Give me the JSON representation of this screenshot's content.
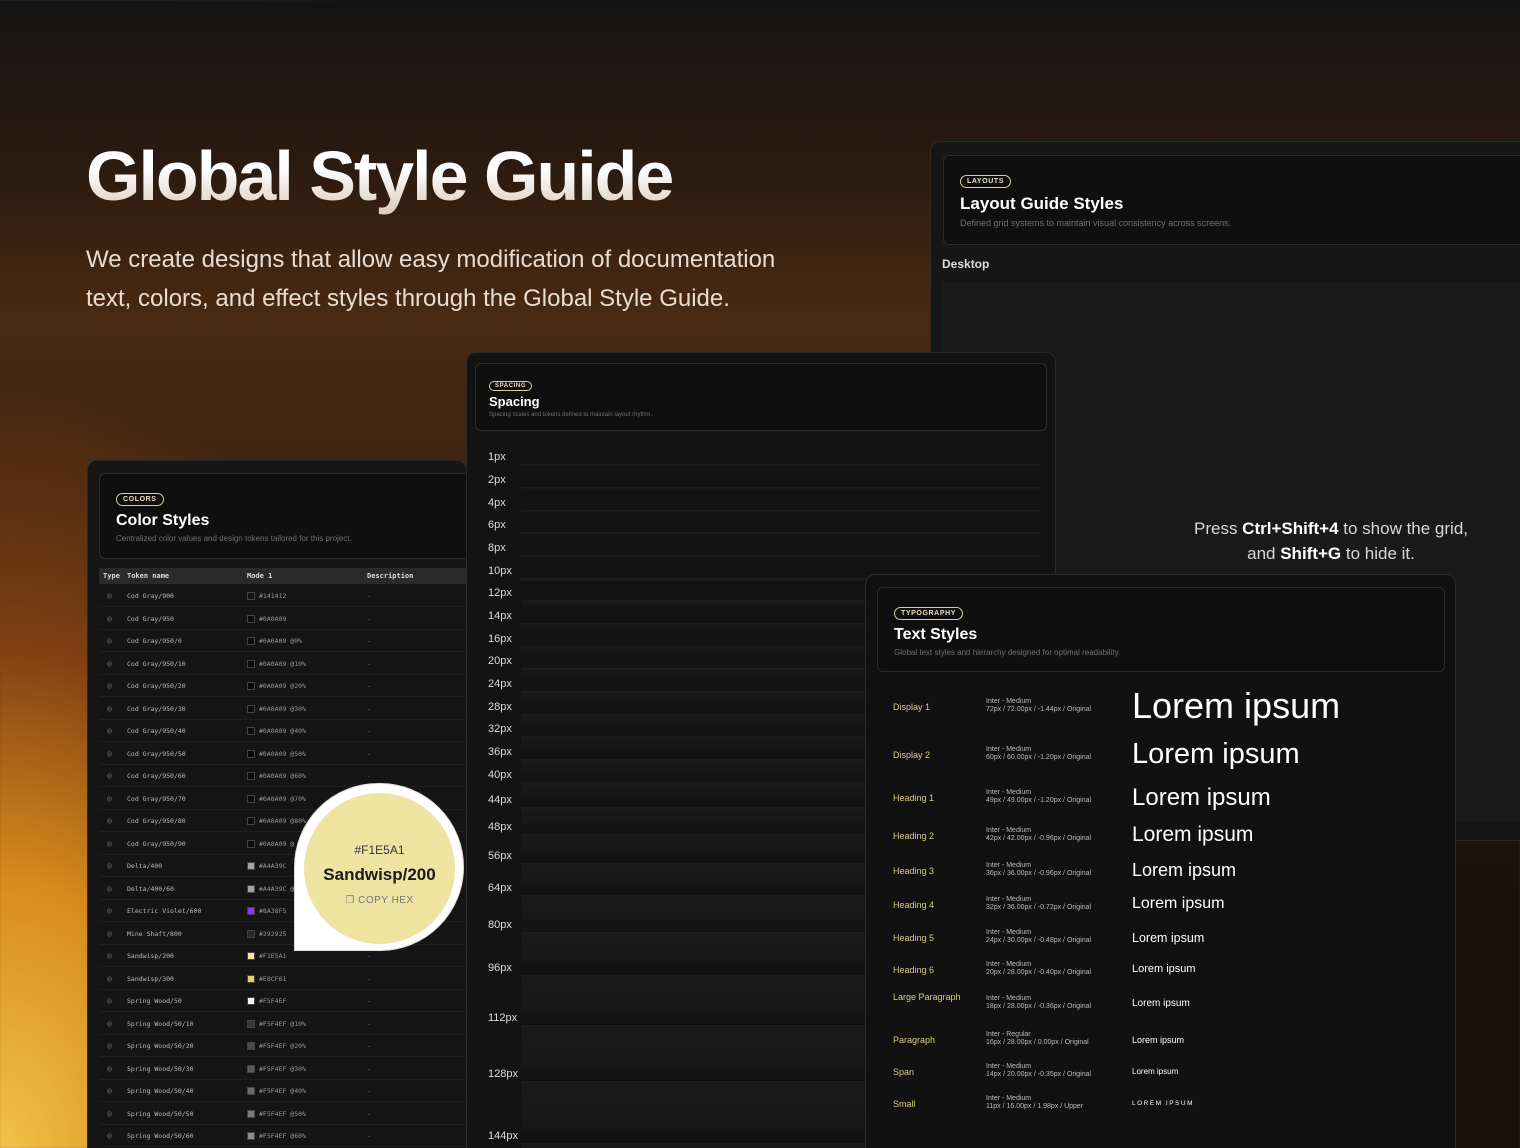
{
  "hero": {
    "title": "Global Style Guide",
    "subtitle": "We create designs that allow easy modification of documentation text, colors, and effect styles through the Global Style Guide."
  },
  "layout_panel": {
    "badge": "LAYOUTS",
    "title": "Layout Guide Styles",
    "description": "Defined grid systems to maintain visual consistency across screens.",
    "tab": "Desktop"
  },
  "grid_hint": {
    "prefix": "Press ",
    "key1": "Ctrl+Shift+4",
    "mid": " to show the grid, and ",
    "key2": "Shift+G",
    "suffix": " to hide it."
  },
  "spacing_panel": {
    "badge": "SPACING",
    "title": "Spacing",
    "description": "Spacing scales and tokens defined to maintain layout rhythm.",
    "items": [
      "1px",
      "2px",
      "4px",
      "6px",
      "8px",
      "10px",
      "12px",
      "14px",
      "16px",
      "20px",
      "24px",
      "28px",
      "32px",
      "36px",
      "40px",
      "44px",
      "48px",
      "56px",
      "64px",
      "80px",
      "96px",
      "112px",
      "128px",
      "144px"
    ]
  },
  "color_panel": {
    "badge": "COLORS",
    "title": "Color Styles",
    "description": "Centralized color values and design tokens tailored for this project.",
    "columns": [
      "Type",
      "Token name",
      "Mode 1",
      "Description"
    ],
    "rows": [
      {
        "name": "Cod Gray/900",
        "hex": "#141412",
        "swatch": "#141412",
        "desc": "-"
      },
      {
        "name": "Cod Gray/950",
        "hex": "#0A0A09",
        "swatch": "#0A0A09",
        "desc": "-"
      },
      {
        "name": "Cod Gray/950/0",
        "hex": "#0A0A09 @0%",
        "swatch": "#0A0A09",
        "desc": "-"
      },
      {
        "name": "Cod Gray/950/10",
        "hex": "#0A0A09 @10%",
        "swatch": "#0A0A09",
        "desc": "-"
      },
      {
        "name": "Cod Gray/950/20",
        "hex": "#0A0A09 @20%",
        "swatch": "#0A0A09",
        "desc": "-"
      },
      {
        "name": "Cod Gray/950/30",
        "hex": "#0A0A09 @30%",
        "swatch": "#0A0A09",
        "desc": "-"
      },
      {
        "name": "Cod Gray/950/40",
        "hex": "#0A0A09 @40%",
        "swatch": "#0A0A09",
        "desc": "-"
      },
      {
        "name": "Cod Gray/950/50",
        "hex": "#0A0A09 @50%",
        "swatch": "#0A0A09",
        "desc": "-"
      },
      {
        "name": "Cod Gray/950/60",
        "hex": "#0A0A09 @60%",
        "swatch": "#0A0A09",
        "desc": "-"
      },
      {
        "name": "Cod Gray/950/70",
        "hex": "#0A0A09 @70%",
        "swatch": "#0A0A09",
        "desc": "-"
      },
      {
        "name": "Cod Gray/950/80",
        "hex": "#0A0A09 @80%",
        "swatch": "#0A0A09",
        "desc": "-"
      },
      {
        "name": "Cod Gray/950/90",
        "hex": "#0A0A09 @",
        "swatch": "#0A0A09",
        "desc": "-"
      },
      {
        "name": "Delta/400",
        "hex": "#A4A39C",
        "swatch": "#A4A39C",
        "desc": "-"
      },
      {
        "name": "Delta/400/60",
        "hex": "#A4A39C @",
        "swatch": "#A4A39C",
        "desc": "-"
      },
      {
        "name": "Electric Violet/600",
        "hex": "#8A38F5",
        "swatch": "#8A38F5",
        "desc": "-"
      },
      {
        "name": "Mine Shaft/800",
        "hex": "#292925",
        "swatch": "#292925",
        "desc": "-"
      },
      {
        "name": "Sandwisp/200",
        "hex": "#F1E5A1",
        "swatch": "#F1E5A1",
        "desc": "-"
      },
      {
        "name": "Sandwisp/300",
        "hex": "#E8CF61",
        "swatch": "#E8CF61",
        "desc": "-"
      },
      {
        "name": "Spring Wood/50",
        "hex": "#F5F4EF",
        "swatch": "#F5F4EF",
        "desc": "-"
      },
      {
        "name": "Spring Wood/50/10",
        "hex": "#F5F4EF @10%",
        "swatch": "#3a3a38",
        "desc": "-"
      },
      {
        "name": "Spring Wood/50/20",
        "hex": "#F5F4EF @20%",
        "swatch": "#4a4a48",
        "desc": "-"
      },
      {
        "name": "Spring Wood/50/30",
        "hex": "#F5F4EF @30%",
        "swatch": "#5a5a58",
        "desc": "-"
      },
      {
        "name": "Spring Wood/50/40",
        "hex": "#F5F4EF @40%",
        "swatch": "#6a6a68",
        "desc": "-"
      },
      {
        "name": "Spring Wood/50/50",
        "hex": "#F5F4EF @50%",
        "swatch": "#7a7a78",
        "desc": "-"
      },
      {
        "name": "Spring Wood/50/60",
        "hex": "#F5F4EF @60%",
        "swatch": "#8a8a88",
        "desc": "-"
      }
    ]
  },
  "copy_popover": {
    "hex": "#F1E5A1",
    "name": "Sandwisp/200",
    "action": "COPY HEX",
    "color": "#efe3a2"
  },
  "type_panel": {
    "badge": "TYPOGRAPHY",
    "title": "Text Styles",
    "description": "Global text styles and hierarchy designed for optimal readability.",
    "styles": [
      {
        "name": "Display 1",
        "font": "Inter - Medium",
        "spec": "72px / 72.00px / -1.44px / Original",
        "sample": "Lorem ipsum"
      },
      {
        "name": "Display 2",
        "font": "Inter - Medium",
        "spec": "60px / 60.00px / -1.20px / Original",
        "sample": "Lorem ipsum"
      },
      {
        "name": "Heading 1",
        "font": "Inter - Medium",
        "spec": "49px / 49.00px / -1.20px / Original",
        "sample": "Lorem ipsum"
      },
      {
        "name": "Heading 2",
        "font": "Inter - Medium",
        "spec": "42px / 42.00px / -0.96px / Original",
        "sample": "Lorem ipsum"
      },
      {
        "name": "Heading 3",
        "font": "Inter - Medium",
        "spec": "36px / 36.00px / -0.96px / Original",
        "sample": "Lorem ipsum"
      },
      {
        "name": "Heading 4",
        "font": "Inter - Medium",
        "spec": "32px / 36.00px / -0.72px / Original",
        "sample": "Lorem ipsum"
      },
      {
        "name": "Heading 5",
        "font": "Inter - Medium",
        "spec": "24px / 30.00px / -0.48px / Original",
        "sample": "Lorem ipsum"
      },
      {
        "name": "Heading 6",
        "font": "Inter - Medium",
        "spec": "20px / 28.00px / -0.40px / Original",
        "sample": "Lorem ipsum"
      },
      {
        "name": "Large Paragraph",
        "font": "Inter - Medium",
        "spec": "18px / 28.00px / -0.36px / Original",
        "sample": "Lorem ipsum"
      },
      {
        "name": "Paragraph",
        "font": "Inter - Regular",
        "spec": "16px / 28.00px / 0.00px / Original",
        "sample": "Lorem ipsum"
      },
      {
        "name": "Span",
        "font": "Inter - Medium",
        "spec": "14px / 20.00px / -0.35px / Original",
        "sample": "Lorem ipsum"
      },
      {
        "name": "Small",
        "font": "Inter - Medium",
        "spec": "11px / 16.00px / 1.98px / Upper",
        "sample": "LOREM IPSUM"
      }
    ]
  }
}
